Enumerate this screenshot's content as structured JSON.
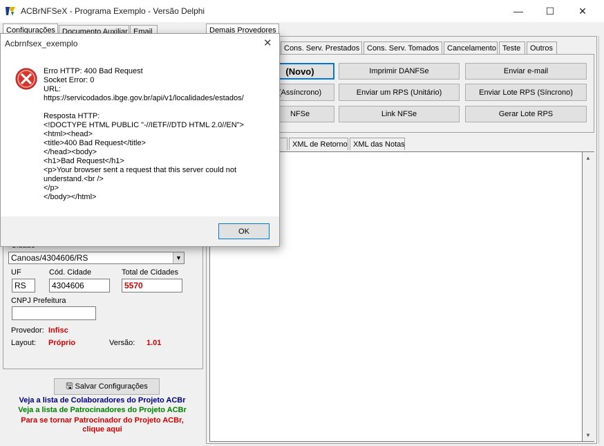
{
  "window": {
    "title": "ACBrNFSeX - Programa Exemplo - Versão Delphi",
    "minimize": "—",
    "maximize": "☐",
    "close": "✕"
  },
  "left_tabs": [
    "Configurações",
    "Documento Auxiliar",
    "Email"
  ],
  "demais_tab": "Demais Provedores",
  "right_tabs": [
    "Cons. Serv. Prestados",
    "Cons. Serv. Tomados",
    "Cancelamento",
    "Teste",
    "Outros"
  ],
  "buttons": {
    "row1": [
      "(Novo)",
      "Imprimir DANFSe",
      "Enviar e-mail"
    ],
    "row2": [
      "(Assíncrono)",
      "Enviar um RPS (Unitário)",
      "Enviar Lote RPS (Síncrono)"
    ],
    "row3": [
      "NFSe",
      "Link NFSe",
      "Gerar Lote RPS"
    ]
  },
  "result_tabs": [
    "o",
    "XML de Retorno",
    "XML das Notas"
  ],
  "config": {
    "cidade_label": "Cidade",
    "cidade_value": "Canoas/4304606/RS",
    "uf_label": "UF",
    "uf_value": "RS",
    "cod_label": "Cód. Cidade",
    "cod_value": "4304606",
    "total_label": "Total de Cidades",
    "total_value": "5570",
    "cnpj_label": "CNPJ Prefeitura",
    "cnpj_value": "",
    "provedor_label": "Provedor:",
    "provedor_value": "Infisc",
    "layout_label": "Layout:",
    "layout_value": "Próprio",
    "versao_label": "Versão:",
    "versao_value": "1.01"
  },
  "save_button": "Salvar Configurações",
  "links": {
    "colaboradores": "Veja a lista de Colaboradores do Projeto ACBr",
    "patrocinadores": "Veja a lista de Patrocinadores do Projeto ACBr",
    "tornar1": "Para se tornar Patrocinador do Projeto ACBr,",
    "tornar2": "clique aqui"
  },
  "dialog": {
    "title": "Acbrnfsex_exemplo",
    "close": "✕",
    "message": "Erro HTTP: 400 Bad Request\nSocket Error: 0\nURL:\nhttps://servicodados.ibge.gov.br/api/v1/localidades/estados/\n\nResposta HTTP:\n<!DOCTYPE HTML PUBLIC \"-//IETF//DTD HTML 2.0//EN\">\n<html><head>\n<title>400 Bad Request</title>\n</head><body>\n<h1>Bad Request</h1>\n<p>Your browser sent a request that this server could not understand.<br />\n</p>\n</body></html>",
    "ok": "OK"
  },
  "colors": {
    "link_blue": "#000080",
    "link_green": "#008000",
    "link_red": "#d00000",
    "error_red": "#d9342b"
  }
}
